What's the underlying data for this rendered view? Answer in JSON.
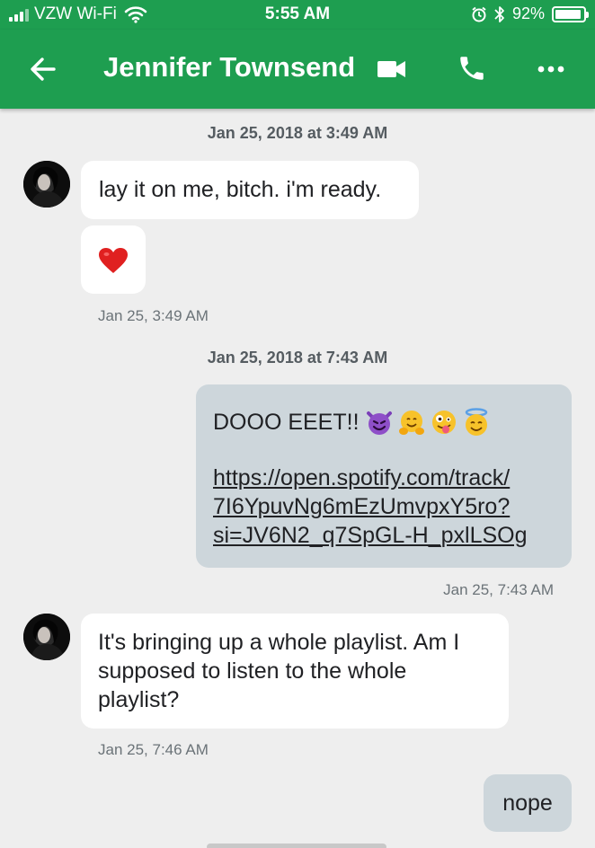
{
  "status_bar": {
    "carrier": "VZW Wi-Fi",
    "time": "5:55 AM",
    "battery": "92%",
    "battery_level": 0.92
  },
  "header": {
    "title": "Jennifer Townsend",
    "icons": [
      "back-arrow-icon",
      "video-call-icon",
      "phone-icon",
      "more-icon"
    ],
    "color": "#1e9e50"
  },
  "messages": {
    "date1": "Jan 25, 2018 at 3:49 AM",
    "m1": "lay it on me, bitch. i'm ready.",
    "m2_emoji": "heart",
    "ts1": "Jan 25, 3:49 AM",
    "date2": "Jan 25, 2018 at 7:43 AM",
    "m3_text": "DOOO EEET!!",
    "m3_emojis": [
      "smiling-devil",
      "hugging-face",
      "zany-face",
      "halo-face"
    ],
    "m3_link": "https://open.spotify.com/track/7I6YpuvNg6mEzUmvpxY5ro?si=JV6N2_q7SpGL-H_pxlLSOg",
    "m3_link_lines": [
      "https://open.spotify.com/track/",
      "7I6YpuvNg6mEzUmvpxY5ro?",
      "si=JV6N2_q7SpGL-H_pxlLSOg"
    ],
    "ts2": "Jan 25, 7:43 AM",
    "m4": "It's bringing up a whole playlist. Am I supposed to listen to the whole playlist?",
    "m4_lines": [
      "It's bringing up a whole playlist. Am I",
      "supposed to listen to the whole",
      "playlist?"
    ],
    "ts3": "Jan 25, 7:46 AM",
    "m5": "nope"
  },
  "colors": {
    "incoming_bubble": "#ffffff",
    "outgoing_bubble": "#cdd6db",
    "background": "#eeeeee"
  }
}
